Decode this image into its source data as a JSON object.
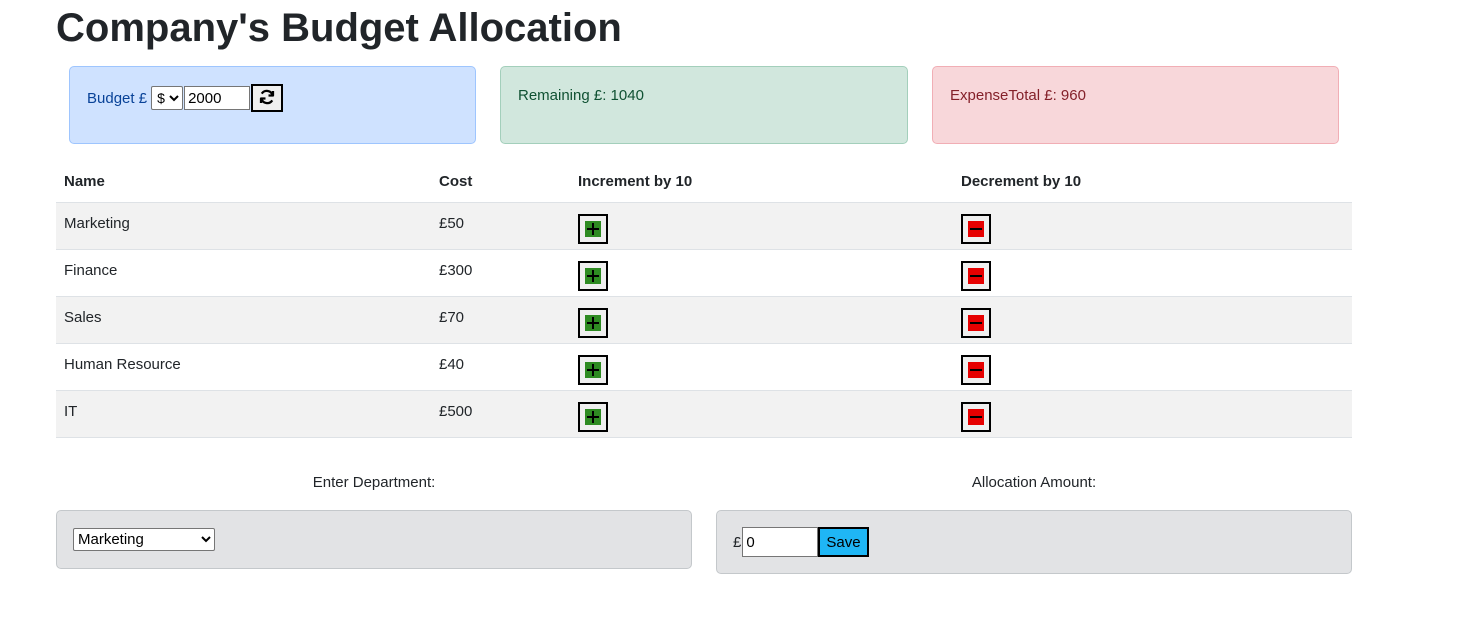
{
  "page": {
    "title": "Company's Budget Allocation"
  },
  "budget_card": {
    "label": "Budget £",
    "currency_selected": "$",
    "currency_options": [
      "$"
    ],
    "budget_value": "2000"
  },
  "remaining_card": {
    "text": "Remaining £: 1040"
  },
  "expense_card": {
    "text": "ExpenseTotal £: 960"
  },
  "table": {
    "headers": {
      "name": "Name",
      "cost": "Cost",
      "increment": "Increment by 10",
      "decrement": "Decrement by 10"
    },
    "rows": [
      {
        "name": "Marketing",
        "cost": "£50"
      },
      {
        "name": "Finance",
        "cost": "£300"
      },
      {
        "name": "Sales",
        "cost": "£70"
      },
      {
        "name": "Human Resource",
        "cost": "£40"
      },
      {
        "name": "IT",
        "cost": "£500"
      }
    ]
  },
  "allocation_form": {
    "department_label": "Enter Department:",
    "department_selected": "Marketing",
    "department_options": [
      "Marketing"
    ],
    "amount_label": "Allocation Amount:",
    "currency_symbol": "£",
    "amount_value": "0",
    "save_label": "Save"
  },
  "colors": {
    "budget_card_bg": "#cfe2ff",
    "remaining_card_bg": "#d1e7dd",
    "expense_card_bg": "#f8d7da",
    "increment_icon": "#2e8b22",
    "decrement_icon": "#e60000",
    "save_button": "#1fb6f5",
    "panel_bg": "#e2e3e5"
  },
  "icons": {
    "refresh": "refresh-icon",
    "increment": "plus-square-icon",
    "decrement": "minus-square-icon"
  }
}
